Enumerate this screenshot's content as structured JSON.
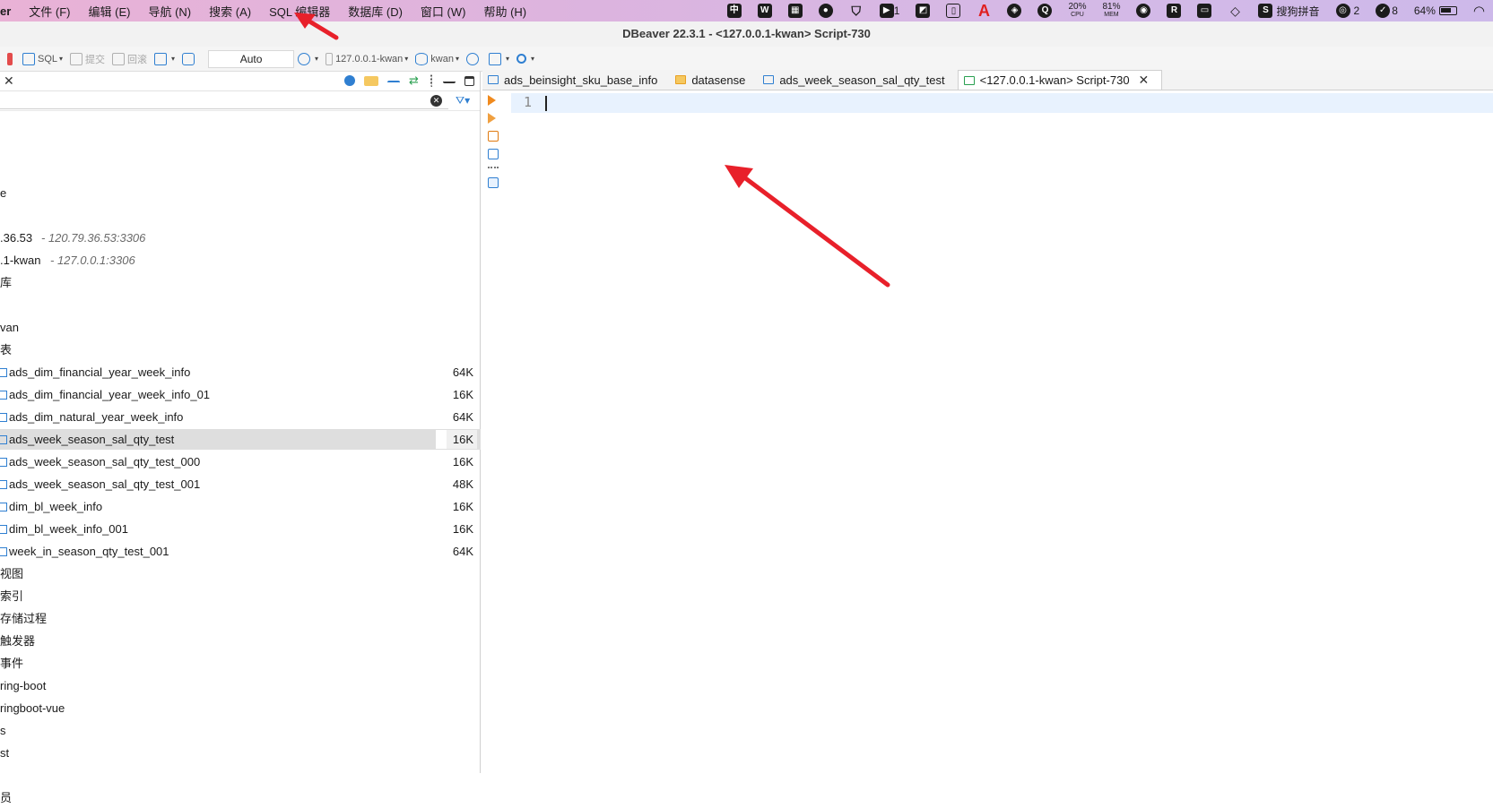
{
  "menubar": {
    "app_name": "er",
    "items": [
      "文件 (F)",
      "编辑 (E)",
      "导航 (N)",
      "搜索 (A)",
      "SQL 编辑器",
      "数据库 (D)",
      "窗口 (W)",
      "帮助 (H)"
    ],
    "status": {
      "badge_count_1": "1",
      "cpu_value": "20%",
      "cpu_label": "CPU",
      "mem_value": "81%",
      "mem_label": "MEM",
      "ime_label": "搜狗拼音",
      "wechat_count": "2",
      "tasks_count": "8",
      "battery": "64%"
    }
  },
  "window": {
    "title": "DBeaver 22.3.1 - <127.0.0.1-kwan> Script-730"
  },
  "toolbar": {
    "sql_label": "SQL",
    "commit_label": "提交",
    "rollback_label": "回滚",
    "tx_mode": "Auto",
    "connection": "127.0.0.1-kwan",
    "database": "kwan"
  },
  "navigator": {
    "filter_placeholder": "",
    "rows": [
      {
        "label": "e"
      },
      {
        "label": ""
      },
      {
        "label": ".36.53",
        "addr": "- 120.79.36.53:3306"
      },
      {
        "label": ".1-kwan",
        "addr": "- 127.0.0.1:3306"
      },
      {
        "label": "库"
      },
      {
        "label": ""
      },
      {
        "label": "van"
      },
      {
        "label": "表"
      },
      {
        "label": "ads_dim_financial_year_week_info",
        "size": "64K",
        "table": true
      },
      {
        "label": "ads_dim_financial_year_week_info_01",
        "size": "16K",
        "table": true
      },
      {
        "label": "ads_dim_natural_year_week_info",
        "size": "64K",
        "table": true
      },
      {
        "label": "ads_week_season_sal_qty_test",
        "size": "16K",
        "table": true,
        "selected": true
      },
      {
        "label": "ads_week_season_sal_qty_test_000",
        "size": "16K",
        "table": true
      },
      {
        "label": "ads_week_season_sal_qty_test_001",
        "size": "48K",
        "table": true
      },
      {
        "label": "dim_bl_week_info",
        "size": "16K",
        "table": true
      },
      {
        "label": "dim_bl_week_info_001",
        "size": "16K",
        "table": true
      },
      {
        "label": "week_in_season_qty_test_001",
        "size": "64K",
        "table": true
      },
      {
        "label": "视图"
      },
      {
        "label": "索引"
      },
      {
        "label": "存储过程"
      },
      {
        "label": "触发器"
      },
      {
        "label": "事件"
      },
      {
        "label": "ring-boot"
      },
      {
        "label": "ringboot-vue"
      },
      {
        "label": "s"
      },
      {
        "label": "st"
      },
      {
        "label": ""
      },
      {
        "label": "员"
      }
    ]
  },
  "editor": {
    "tabs": [
      {
        "label": "ads_beinsight_sku_base_info",
        "icon": "table-icon"
      },
      {
        "label": "datasense",
        "icon": "folder-icon"
      },
      {
        "label": "ads_week_season_sal_qty_test",
        "icon": "table-icon"
      },
      {
        "label": "<127.0.0.1-kwan> Script-730",
        "icon": "script-icon",
        "active": true
      }
    ],
    "line_number": "1",
    "content": ""
  },
  "colors": {
    "accent": "#2f7fd1",
    "run": "#f08a1e",
    "annotation_arrow": "#e8202a",
    "selection": "#dedede"
  }
}
